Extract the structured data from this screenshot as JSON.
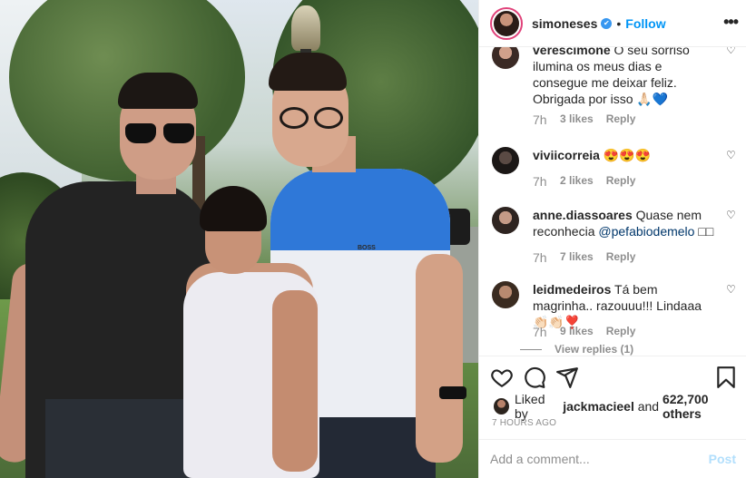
{
  "header": {
    "username": "simoneses",
    "verified_mark": "✔",
    "separator": "•",
    "follow_label": "Follow",
    "more_icon": "more-horizontal-icon",
    "more_glyph": "•••"
  },
  "comments": [
    {
      "username": "verescimone",
      "text": "O seu sorriso ilumina os meus dias e consegue me deixar feliz. Obrigada por isso 🙏🏻💙",
      "time": "7h",
      "likes": "3 likes",
      "reply_label": "Reply"
    },
    {
      "username": "viviicorreia",
      "text": "😍😍😍",
      "time": "7h",
      "likes": "2 likes",
      "reply_label": "Reply"
    },
    {
      "username": "anne.diassoares",
      "text": "Quase nem reconhecia",
      "mention": "@pefabiodemelo",
      "text_suffix": "□□",
      "time": "7h",
      "likes": "7 likes",
      "reply_label": "Reply"
    },
    {
      "username": "leidmedeiros",
      "text": "Tá bem magrinha.. razouuu!!! Lindaaa 👏🏻👏🏻❣️",
      "time": "7h",
      "likes": "9 likes",
      "reply_label": "Reply",
      "view_replies": "View replies (1)"
    }
  ],
  "actions": {
    "icons": [
      "heart-icon",
      "comment-icon",
      "share-icon",
      "bookmark-icon"
    ]
  },
  "likes_line": {
    "prefix": "Liked by",
    "user": "jackmacieel",
    "connector": "and",
    "others": "622,700 others"
  },
  "time_ago": "7 HOURS AGO",
  "add_comment": {
    "placeholder": "Add a comment...",
    "post_label": "Post"
  },
  "photo": {
    "shirt_logo": "BOSS"
  },
  "colors": {
    "follow_blue": "#0095f6",
    "post_disabled": "#b2dffc",
    "meta_gray": "#8e8e8e",
    "text": "#262626"
  }
}
